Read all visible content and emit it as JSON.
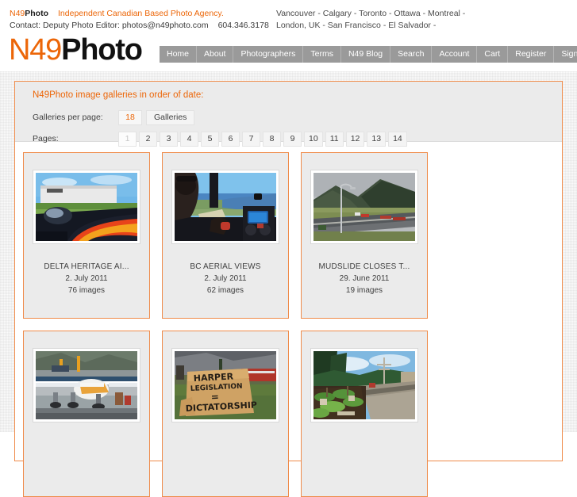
{
  "topbar": {
    "brand_n49": "N49",
    "brand_photo": "Photo",
    "tagline": "Independent Canadian Based Photo Agency.",
    "contact": "Contact: Deputy Photo Editor: photos@n49photo.com",
    "phone": "604.346.3178",
    "cities_line1": "Vancouver - Calgary - Toronto - Ottawa - Montreal -",
    "cities_line2": "London, UK - San Francisco - El Salvador -"
  },
  "logo": {
    "part1": "N49",
    "part2": "Photo"
  },
  "nav": {
    "items": [
      {
        "label": "Home"
      },
      {
        "label": "About"
      },
      {
        "label": "Photographers"
      },
      {
        "label": "Terms"
      },
      {
        "label": "N49 Blog"
      },
      {
        "label": "Search"
      },
      {
        "label": "Account"
      },
      {
        "label": "Cart"
      },
      {
        "label": "Register"
      },
      {
        "label": "Sign In"
      }
    ]
  },
  "panel": {
    "title": "N49Photo image galleries in order of date:",
    "per_page_label": "Galleries per page:",
    "per_page_value": "18",
    "per_page_unit": "Galleries",
    "pages_label": "Pages:",
    "pages": [
      "1",
      "2",
      "3",
      "4",
      "5",
      "6",
      "7",
      "8",
      "9",
      "10",
      "11",
      "12",
      "13",
      "14"
    ],
    "active_page": "1"
  },
  "galleries": [
    {
      "title": "DELTA HERITAGE AI...",
      "date": "2. July 2011",
      "count": "76 images",
      "thumb": "airplane-flames"
    },
    {
      "title": "BC AERIAL VIEWS",
      "date": "2. July 2011",
      "count": "62 images",
      "thumb": "cockpit-aerial"
    },
    {
      "title": "MUDSLIDE CLOSES T...",
      "date": "29. June 2011",
      "count": "19 images",
      "thumb": "mudslide-highway"
    },
    {
      "title": "",
      "date": "",
      "count": "",
      "thumb": "seaplane-dock"
    },
    {
      "title": "",
      "date": "",
      "count": "",
      "thumb": "protest-sign"
    },
    {
      "title": "",
      "date": "",
      "count": "",
      "thumb": "community-garden"
    }
  ],
  "colors": {
    "accent": "#ec6608",
    "border": "#ef8b4a",
    "nav_bg": "#9a9a9a",
    "card_bg": "#ebebeb"
  }
}
